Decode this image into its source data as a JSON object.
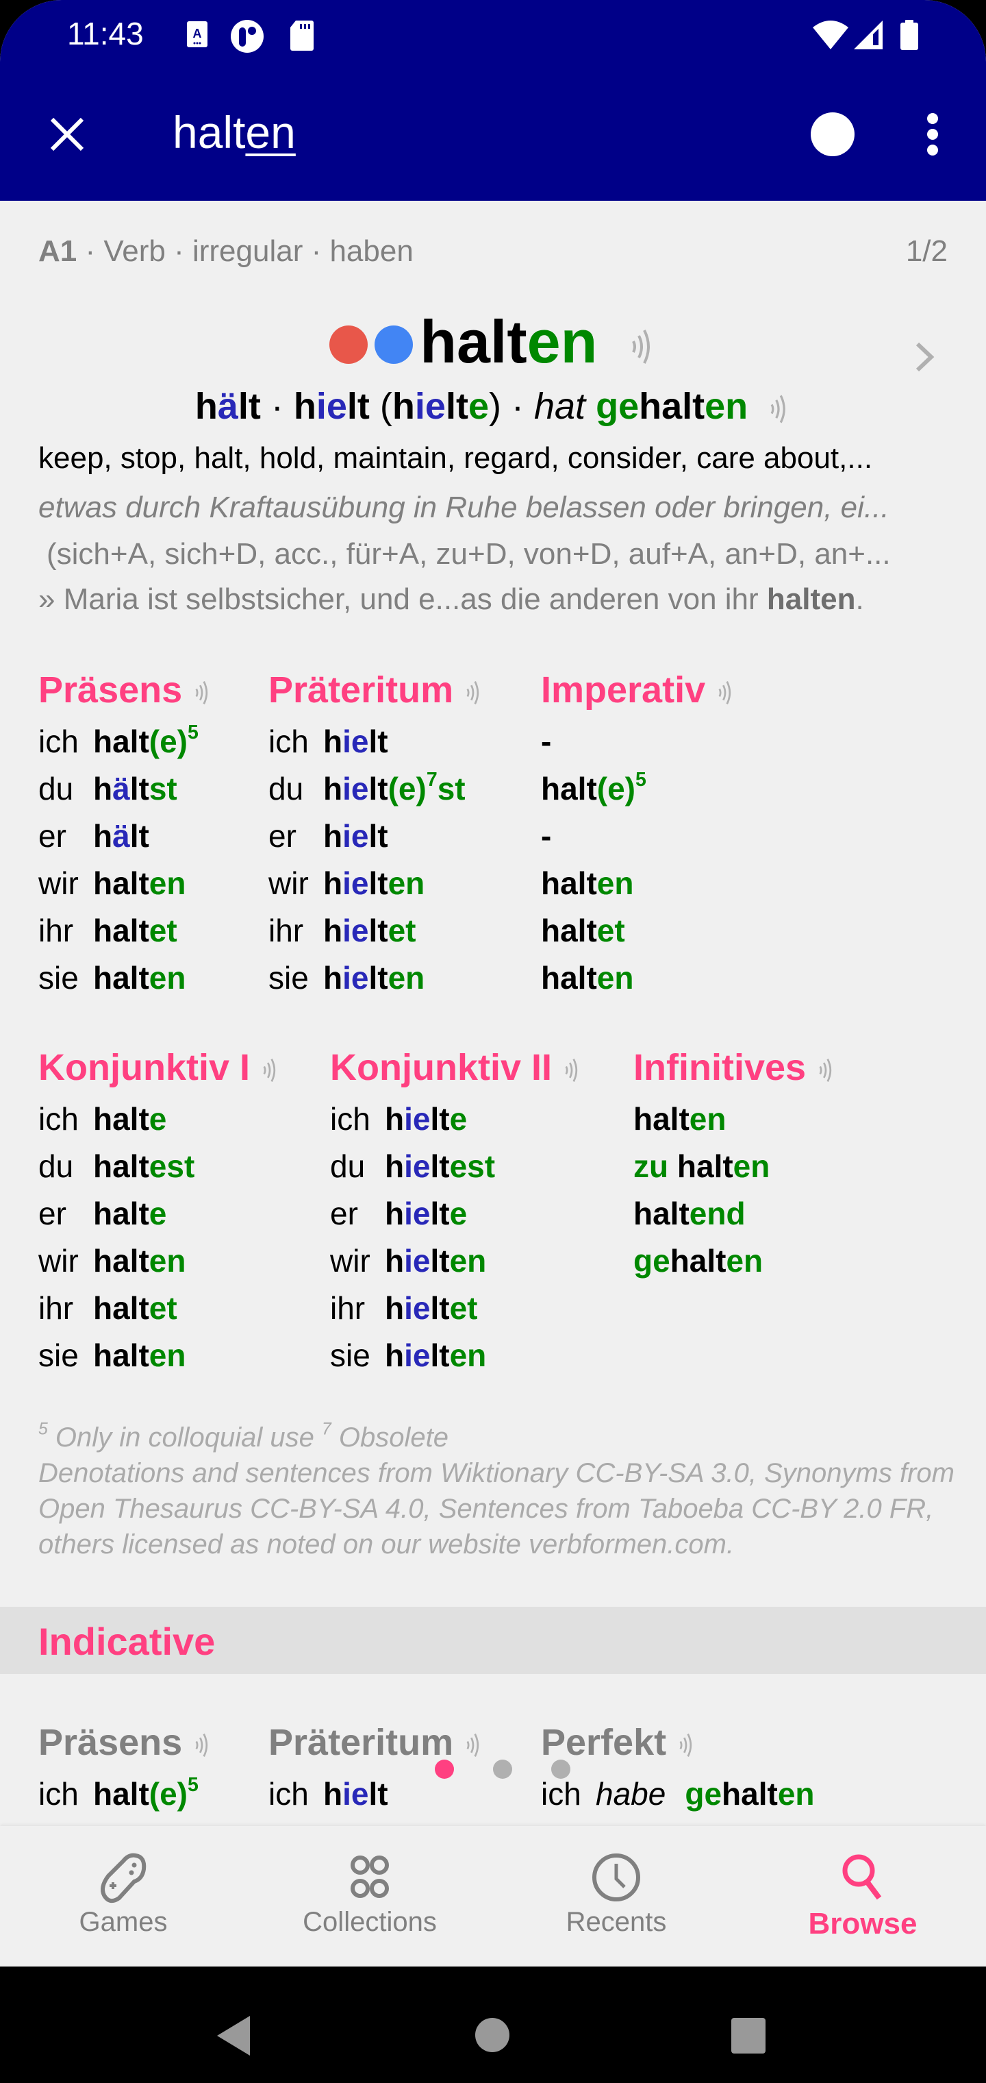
{
  "status_bar": {
    "time": "11:43",
    "left_icons": [
      "accessibility-a-icon",
      "app-notification-icon",
      "sd-card-icon"
    ],
    "right_icons": [
      "wifi-icon",
      "cell-signal-icon",
      "battery-icon"
    ]
  },
  "toolbar": {
    "close_icon": "close-icon",
    "query_plain": "halt",
    "query_underlined": "en",
    "record_icon": "record-circle-icon",
    "more_icon": "more-vert-icon"
  },
  "entry": {
    "level": "A1",
    "meta_rest": " · Verb · irregular · haben",
    "pager": "1/2",
    "headword_stem": "halt",
    "headword_ending": "en",
    "dot_colors": [
      "#e8574a",
      "#4285f4"
    ],
    "forms": {
      "p1a": "h",
      "p1b": "ä",
      "p1c": "lt",
      "sep1": " · ",
      "p2a": "h",
      "p2b": "ie",
      "p2c": "lt",
      "paren_open": " (",
      "p3a": "h",
      "p3b": "ie",
      "p3c": "lt",
      "p3d": "e",
      "paren_close": ")",
      "sep2": " · ",
      "aux": "hat",
      "space": " ",
      "p4a": "ge",
      "p4b": "halt",
      "p4c": "en"
    },
    "translation": "keep, stop, halt, hold, maintain, regard, consider, care about,...",
    "definition": "etwas durch Kraftausübung in Ruhe belassen oder bringen, ei...",
    "prepositions": "(sich+A, sich+D, acc., für+A, zu+D, von+D, auf+A, an+D, an+...",
    "example_prefix": "» Maria ist selbstsicher, und e...as die anderen von ihr ",
    "example_bold": "halten",
    "example_suffix": "."
  },
  "tables": {
    "praesens": {
      "title": "Präsens",
      "rows": [
        {
          "pron": "ich",
          "parts": [
            [
              "halt",
              "k"
            ],
            [
              "(e)",
              "g"
            ]
          ],
          "sup": "5"
        },
        {
          "pron": "du",
          "parts": [
            [
              "h",
              "k"
            ],
            [
              "ä",
              "b"
            ],
            [
              "lt",
              "k"
            ],
            [
              "st",
              "g"
            ]
          ]
        },
        {
          "pron": "er",
          "parts": [
            [
              "h",
              "k"
            ],
            [
              "ä",
              "b"
            ],
            [
              "lt",
              "k"
            ]
          ]
        },
        {
          "pron": "wir",
          "parts": [
            [
              "halt",
              "k"
            ],
            [
              "en",
              "g"
            ]
          ]
        },
        {
          "pron": "ihr",
          "parts": [
            [
              "halt",
              "k"
            ],
            [
              "et",
              "g"
            ]
          ]
        },
        {
          "pron": "sie",
          "parts": [
            [
              "halt",
              "k"
            ],
            [
              "en",
              "g"
            ]
          ]
        }
      ]
    },
    "praeteritum": {
      "title": "Präteritum",
      "rows": [
        {
          "pron": "ich",
          "parts": [
            [
              "h",
              "k"
            ],
            [
              "ie",
              "b"
            ],
            [
              "lt",
              "k"
            ]
          ]
        },
        {
          "pron": "du",
          "parts": [
            [
              "h",
              "k"
            ],
            [
              "ie",
              "b"
            ],
            [
              "lt",
              "k"
            ],
            [
              "(e)",
              "g"
            ]
          ],
          "sup": "7",
          "after": [
            [
              "st",
              "g"
            ]
          ]
        },
        {
          "pron": "er",
          "parts": [
            [
              "h",
              "k"
            ],
            [
              "ie",
              "b"
            ],
            [
              "lt",
              "k"
            ]
          ]
        },
        {
          "pron": "wir",
          "parts": [
            [
              "h",
              "k"
            ],
            [
              "ie",
              "b"
            ],
            [
              "lt",
              "k"
            ],
            [
              "en",
              "g"
            ]
          ]
        },
        {
          "pron": "ihr",
          "parts": [
            [
              "h",
              "k"
            ],
            [
              "ie",
              "b"
            ],
            [
              "lt",
              "k"
            ],
            [
              "et",
              "g"
            ]
          ]
        },
        {
          "pron": "sie",
          "parts": [
            [
              "h",
              "k"
            ],
            [
              "ie",
              "b"
            ],
            [
              "lt",
              "k"
            ],
            [
              "en",
              "g"
            ]
          ]
        }
      ]
    },
    "imperativ": {
      "title": "Imperativ",
      "rows": [
        {
          "pron": "",
          "parts": [
            [
              "-",
              "k"
            ]
          ]
        },
        {
          "pron": "",
          "parts": [
            [
              "halt",
              "k"
            ],
            [
              "(e)",
              "g"
            ]
          ],
          "sup": "5"
        },
        {
          "pron": "",
          "parts": [
            [
              "-",
              "k"
            ]
          ]
        },
        {
          "pron": "",
          "parts": [
            [
              "halt",
              "k"
            ],
            [
              "en",
              "g"
            ]
          ]
        },
        {
          "pron": "",
          "parts": [
            [
              "halt",
              "k"
            ],
            [
              "et",
              "g"
            ]
          ]
        },
        {
          "pron": "",
          "parts": [
            [
              "halt",
              "k"
            ],
            [
              "en",
              "g"
            ]
          ]
        }
      ]
    },
    "konjunktiv1": {
      "title": "Konjunktiv I",
      "rows": [
        {
          "pron": "ich",
          "parts": [
            [
              "halt",
              "k"
            ],
            [
              "e",
              "g"
            ]
          ]
        },
        {
          "pron": "du",
          "parts": [
            [
              "halt",
              "k"
            ],
            [
              "est",
              "g"
            ]
          ]
        },
        {
          "pron": "er",
          "parts": [
            [
              "halt",
              "k"
            ],
            [
              "e",
              "g"
            ]
          ]
        },
        {
          "pron": "wir",
          "parts": [
            [
              "halt",
              "k"
            ],
            [
              "en",
              "g"
            ]
          ]
        },
        {
          "pron": "ihr",
          "parts": [
            [
              "halt",
              "k"
            ],
            [
              "et",
              "g"
            ]
          ]
        },
        {
          "pron": "sie",
          "parts": [
            [
              "halt",
              "k"
            ],
            [
              "en",
              "g"
            ]
          ]
        }
      ]
    },
    "konjunktiv2": {
      "title": "Konjunktiv II",
      "rows": [
        {
          "pron": "ich",
          "parts": [
            [
              "h",
              "k"
            ],
            [
              "ie",
              "b"
            ],
            [
              "lt",
              "k"
            ],
            [
              "e",
              "g"
            ]
          ]
        },
        {
          "pron": "du",
          "parts": [
            [
              "h",
              "k"
            ],
            [
              "ie",
              "b"
            ],
            [
              "lt",
              "k"
            ],
            [
              "est",
              "g"
            ]
          ]
        },
        {
          "pron": "er",
          "parts": [
            [
              "h",
              "k"
            ],
            [
              "ie",
              "b"
            ],
            [
              "lt",
              "k"
            ],
            [
              "e",
              "g"
            ]
          ]
        },
        {
          "pron": "wir",
          "parts": [
            [
              "h",
              "k"
            ],
            [
              "ie",
              "b"
            ],
            [
              "lt",
              "k"
            ],
            [
              "en",
              "g"
            ]
          ]
        },
        {
          "pron": "ihr",
          "parts": [
            [
              "h",
              "k"
            ],
            [
              "ie",
              "b"
            ],
            [
              "lt",
              "k"
            ],
            [
              "et",
              "g"
            ]
          ]
        },
        {
          "pron": "sie",
          "parts": [
            [
              "h",
              "k"
            ],
            [
              "ie",
              "b"
            ],
            [
              "lt",
              "k"
            ],
            [
              "en",
              "g"
            ]
          ]
        }
      ]
    },
    "infinitives": {
      "title": "Infinitives",
      "rows": [
        {
          "pron": "",
          "parts": [
            [
              "halt",
              "k"
            ],
            [
              "en",
              "g"
            ]
          ]
        },
        {
          "pron": "",
          "parts": [
            [
              "zu ",
              "g"
            ],
            [
              "halt",
              "k"
            ],
            [
              "en",
              "g"
            ]
          ]
        },
        {
          "pron": "",
          "parts": [
            [
              "halt",
              "k"
            ],
            [
              "end",
              "g"
            ]
          ]
        },
        {
          "pron": "",
          "parts": [
            [
              "ge",
              "g"
            ],
            [
              "halt",
              "k"
            ],
            [
              "en",
              "g"
            ]
          ]
        }
      ]
    }
  },
  "footnote": {
    "sup5": "5",
    "note5": " Only in colloquial use ",
    "sup7": "7",
    "note7": " Obsolete",
    "license": "Denotations and sentences from Wiktionary CC-BY-SA 3.0, Synonyms from Open Thesaurus CC-BY-SA 4.0, Sentences from Taboeba CC-BY 2.0 FR, others licensed as noted on our website verbformen.com."
  },
  "indicative": {
    "title": "Indicative",
    "columns": [
      {
        "title": "Präsens",
        "first_row": {
          "pron": "ich",
          "parts": [
            [
              "halt",
              "k"
            ],
            [
              "(e)",
              "g"
            ]
          ],
          "sup": "5"
        }
      },
      {
        "title": "Präteritum",
        "first_row": {
          "pron": "ich",
          "parts": [
            [
              "h",
              "k"
            ],
            [
              "ie",
              "b"
            ],
            [
              "lt",
              "k"
            ]
          ]
        }
      },
      {
        "title": "Perfekt",
        "first_row": {
          "pron": "ich",
          "aux": "habe",
          "parts": [
            [
              "ge",
              "g"
            ],
            [
              "halt",
              "k"
            ],
            [
              "en",
              "g"
            ]
          ]
        }
      }
    ]
  },
  "page_indicator": {
    "count": 3,
    "active": 0
  },
  "bottom_nav": {
    "items": [
      {
        "label": "Games",
        "icon": "gamepad-icon",
        "active": false
      },
      {
        "label": "Collections",
        "icon": "collections-icon",
        "active": false
      },
      {
        "label": "Recents",
        "icon": "clock-icon",
        "active": false
      },
      {
        "label": "Browse",
        "icon": "search-icon",
        "active": true
      }
    ]
  },
  "system_nav": [
    "back-icon",
    "home-icon",
    "recents-icon"
  ],
  "colors": {
    "appbar": "#000088",
    "accent": "#ff4081",
    "ending_green": "#008800",
    "vowel_blue": "#2828b8",
    "muted": "#808080"
  }
}
